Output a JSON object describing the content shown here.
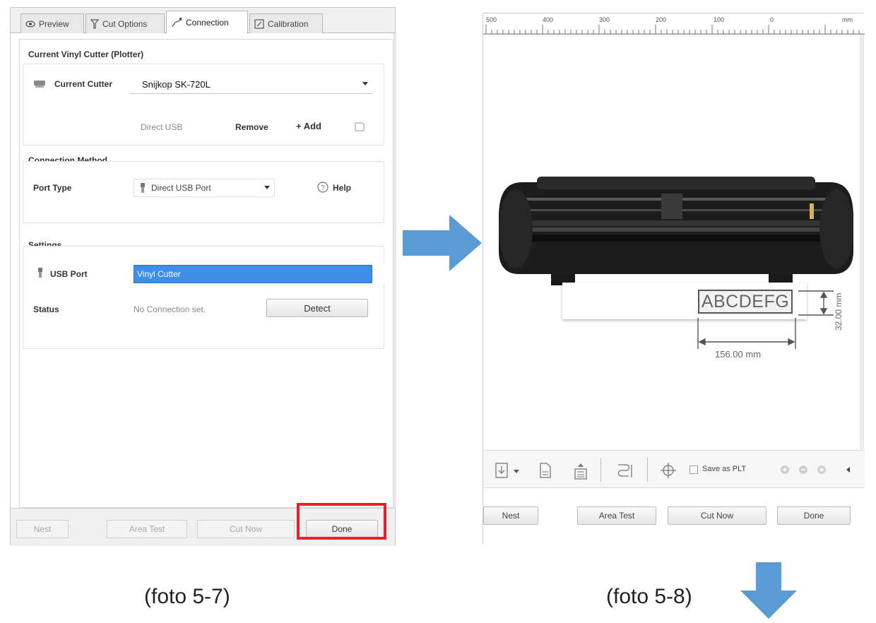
{
  "left_panel": {
    "tabs": [
      {
        "label": "Preview"
      },
      {
        "label": "Cut Options"
      },
      {
        "label": "Connection"
      },
      {
        "label": "Calibration"
      }
    ],
    "current_cutter_section": {
      "title": "Current Vinyl Cutter (Plotter)",
      "cutter_label": "Current Cutter",
      "cutter_value": "Snijkop SK-720L",
      "connection_text": "Direct USB",
      "remove_label": "Remove",
      "add_label": "+ Add"
    },
    "connection_method": {
      "title": "Connection Method",
      "port_type_label": "Port Type",
      "port_type_value": "Direct USB Port",
      "help_label": "Help"
    },
    "settings": {
      "title": "Settings",
      "usb_port_label": "USB Port",
      "usb_port_value": "Vinyl Cutter",
      "status_label": "Status",
      "status_value": "No Connection set.",
      "detect_label": "Detect"
    },
    "buttons": {
      "nest": "Nest",
      "area_test": "Area Test",
      "cut_now": "Cut Now",
      "done": "Done"
    },
    "highlight_color": "#e8202a"
  },
  "right_panel": {
    "ruler": {
      "labels": [
        "500",
        "400",
        "300",
        "200",
        "100",
        "0"
      ],
      "unit": "mm"
    },
    "design": {
      "text": "ABCDEFG",
      "width_label": "156.00 mm",
      "height_label": "32.00 mm"
    },
    "toolbar": {
      "save_as_plt": "Save as PLT"
    },
    "buttons": {
      "nest": "Nest",
      "area_test": "Area Test",
      "cut_now": "Cut Now",
      "done": "Done"
    }
  },
  "captions": {
    "left": "(foto  5-7)",
    "right": "(foto  5-8)"
  },
  "arrow_color": "#5b9bd5"
}
